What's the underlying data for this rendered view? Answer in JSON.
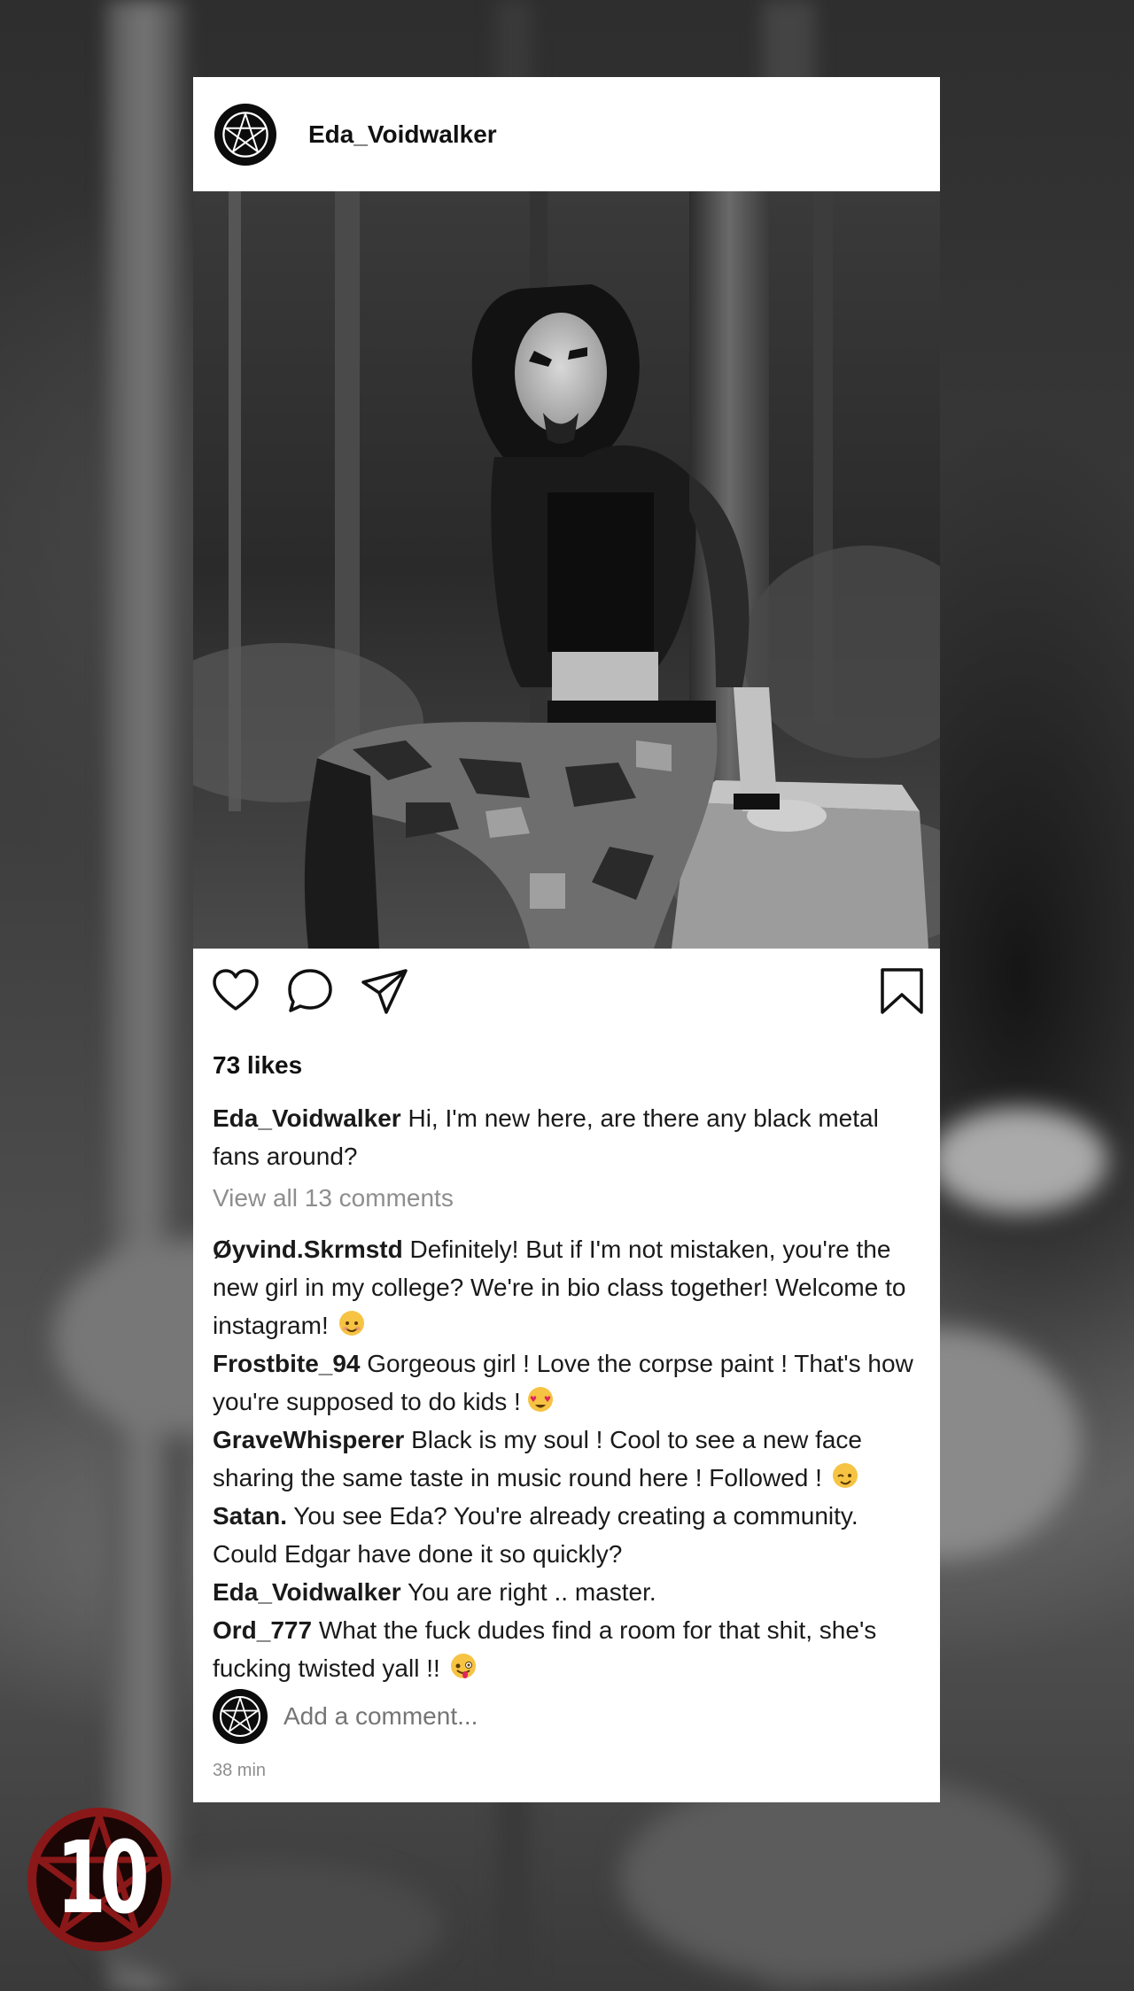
{
  "post": {
    "username": "Eda_Voidwalker",
    "likes": "73 likes",
    "caption": {
      "user": "Eda_Voidwalker",
      "text": " Hi, I'm new here, are there any black metal fans around?"
    },
    "view_all": "View all 13 comments",
    "comments": [
      {
        "user": "Øyvind.Skrmstd",
        "text": " Definitely! But if I'm not mistaken, you're the new girl in my college? We're in bio class together! Welcome to instagram!",
        "emoji": "smiling-face"
      },
      {
        "user": "Frostbite_94",
        "text": " Gorgeous girl ! Love the corpse paint ! That's how you're supposed to do kids !",
        "emoji": "heart-eyes-face"
      },
      {
        "user": "GraveWhisperer",
        "text": " Black is my soul ! Cool to see a new face sharing the same taste in music round here ! Followed !",
        "emoji": "winking-face"
      },
      {
        "user": "Satan.",
        "text": " You see Eda? You're already creating a community. Could Edgar have done it so quickly?",
        "emoji": ""
      },
      {
        "user": "Eda_Voidwalker",
        "text": " You are right .. master.",
        "emoji": ""
      },
      {
        "user": "Ord_777",
        "text": " What the fuck dudes find a room for that shit, she's fucking twisted yall !!",
        "emoji": "zany-face"
      }
    ],
    "add_comment_placeholder": "Add a comment...",
    "timestamp": "38 min"
  },
  "badge": {
    "number": "10",
    "icon": "pentagram-circle-icon"
  },
  "icons": [
    "pentagram-avatar-icon",
    "heart-icon",
    "comment-icon",
    "share-icon",
    "bookmark-icon"
  ]
}
